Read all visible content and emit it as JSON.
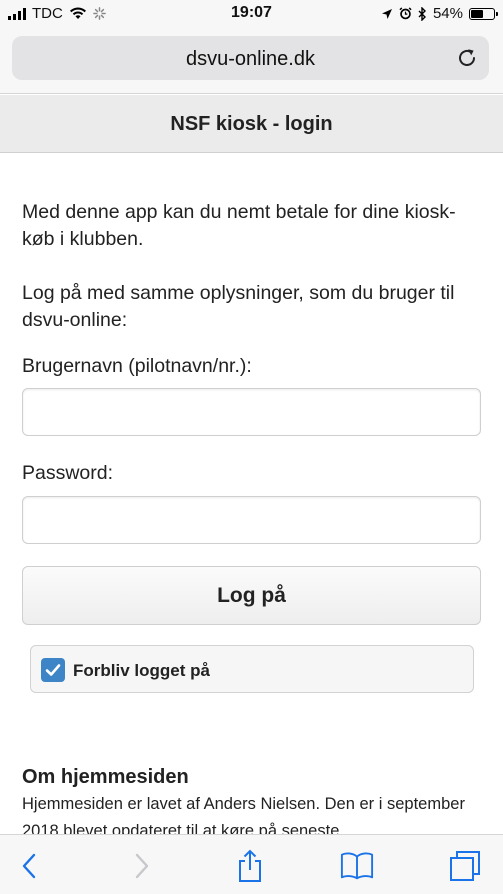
{
  "status_bar": {
    "carrier": "TDC",
    "time": "19:07",
    "battery_percent": "54%",
    "battery_level": 0.54
  },
  "browser": {
    "url": "dsvu-online.dk"
  },
  "page": {
    "title": "NSF kiosk - login",
    "intro": "Med denne app kan du nemt betale for dine kiosk-køb i klubben.",
    "login_hint": "Log på med samme oplysninger, som du bruger til dsvu-online:",
    "username_label": "Brugernavn (pilotnavn/nr.):",
    "username_value": "",
    "password_label": "Password:",
    "password_value": "",
    "login_button": "Log på",
    "remember_label": "Forbliv logget på",
    "remember_checked": true,
    "about_heading": "Om hjemmesiden",
    "about_text": "Hjemmesiden er lavet af Anders Nielsen. Den er i september 2018 blevet opdateret til at køre på seneste"
  },
  "colors": {
    "accent": "#3d85c6",
    "ios_blue": "#1a73e8",
    "disabled": "#c7c7cc"
  }
}
